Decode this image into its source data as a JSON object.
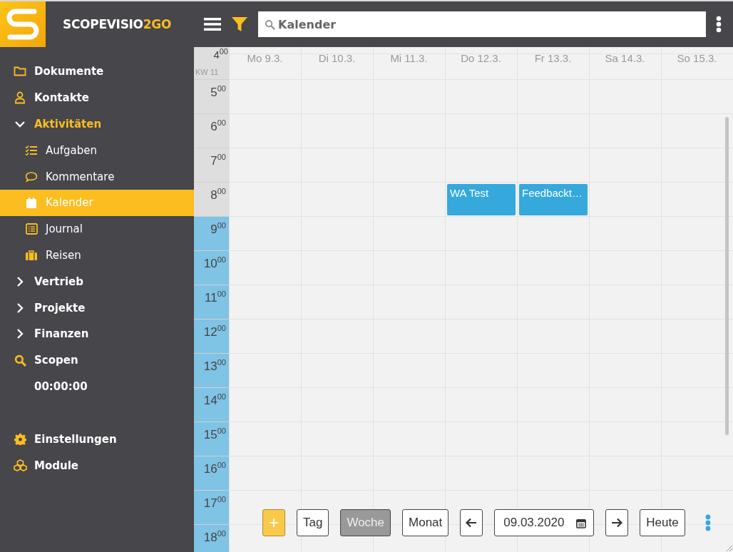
{
  "app": {
    "name": "SCOPEVISIO",
    "name_suffix": "2GO"
  },
  "search": {
    "placeholder": "Kalender"
  },
  "sidebar": {
    "items": [
      {
        "label": "Dokumente",
        "kind": "link",
        "selected": false
      },
      {
        "label": "Kontakte",
        "kind": "link",
        "selected": false
      },
      {
        "label": "Aktivitäten",
        "kind": "group",
        "expanded": true,
        "children": [
          {
            "label": "Aufgaben",
            "selected": false
          },
          {
            "label": "Kommentare",
            "selected": false
          },
          {
            "label": "Kalender",
            "selected": true
          },
          {
            "label": "Journal",
            "selected": false
          },
          {
            "label": "Reisen",
            "selected": false
          }
        ]
      },
      {
        "label": "Vertrieb",
        "kind": "group",
        "expanded": false
      },
      {
        "label": "Projekte",
        "kind": "group",
        "expanded": false
      },
      {
        "label": "Finanzen",
        "kind": "group",
        "expanded": false
      },
      {
        "label": "Scopen",
        "kind": "link",
        "selected": false
      },
      {
        "label": "00:00:00",
        "kind": "timer"
      }
    ],
    "footer_items": [
      {
        "label": "Einstellungen",
        "selected": false
      },
      {
        "label": "Module",
        "selected": false
      }
    ]
  },
  "calendar": {
    "week_label": "KW 11",
    "days": [
      {
        "label": "Mo 9.3."
      },
      {
        "label": "Di 10.3."
      },
      {
        "label": "Mi 11.3."
      },
      {
        "label": "Do 12.3."
      },
      {
        "label": "Fr 13.3."
      },
      {
        "label": "Sa 14.3."
      },
      {
        "label": "So 15.3."
      }
    ],
    "hours": [
      {
        "label": "4$^{00}$",
        "working": false
      },
      {
        "label": "5$^{00}$",
        "working": false
      },
      {
        "label": "6$^{00}$",
        "working": false
      },
      {
        "label": "7$^{00}$",
        "working": false
      },
      {
        "label": "8$^{00}$",
        "working": false,
        "events": [
          {
            "title": "WA Test",
            "kind": "thursday"
          },
          {
            "title": "Feedbackt…",
            "kind": "friday"
          }
        ]
      },
      {
        "label": "9$^{00}$",
        "working": true
      },
      {
        "label": "10$^{00}$",
        "working": true
      },
      {
        "label": "11$^{00}$",
        "working": true
      },
      {
        "label": "12$^{00}$",
        "working": true
      },
      {
        "label": "13$^{00}$",
        "working": true
      },
      {
        "label": "14$^{00}$",
        "working": true
      },
      {
        "label": "15$^{00}$",
        "working": true
      },
      {
        "label": "16$^{00}$",
        "working": true
      },
      {
        "label": "17$^{00}$",
        "working": true
      },
      {
        "label": "18$^{00}$",
        "working": true
      }
    ]
  },
  "toolbar": {
    "add": "+",
    "views": [
      {
        "label": "Tag",
        "selected": false
      },
      {
        "label": "Woche",
        "selected": true
      },
      {
        "label": "Monat",
        "selected": false
      }
    ],
    "date": "09.03.2020",
    "today": "Heute"
  }
}
